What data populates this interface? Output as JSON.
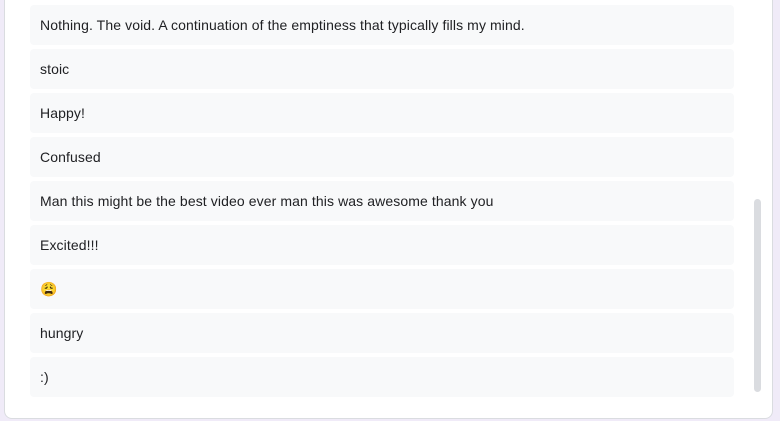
{
  "responses": [
    "Nothing. The void. A continuation of the emptiness that typically fills my mind.",
    "stoic",
    "Happy!",
    "Confused",
    "Man this might be the best video ever man this was awesome thank you",
    "Excited!!!",
    "😩",
    "hungry",
    ":)"
  ]
}
